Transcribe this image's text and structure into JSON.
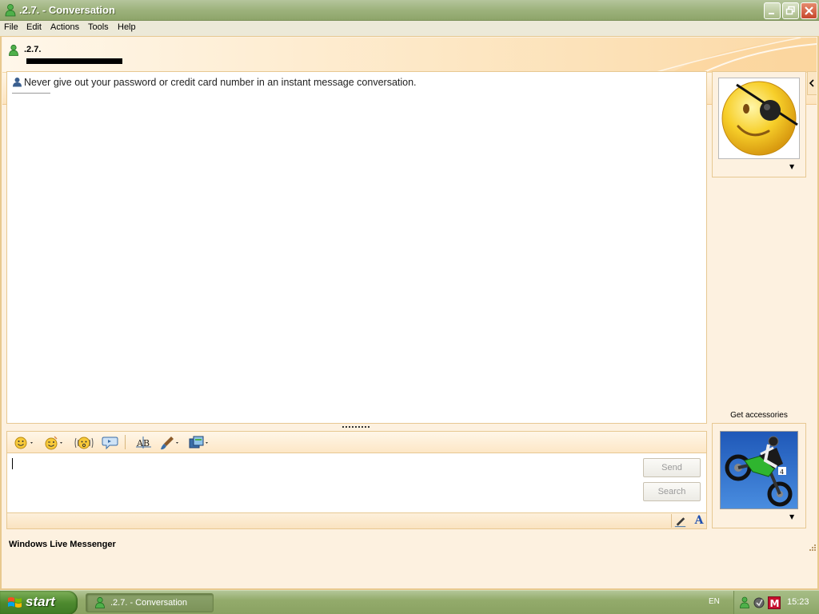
{
  "window": {
    "title": ".2.7. - Conversation",
    "brand": "Windows Live Messenger"
  },
  "menu": {
    "items": [
      "File",
      "Edit",
      "Actions",
      "Tools",
      "Help"
    ]
  },
  "contact": {
    "name": ".2.7.",
    "status_redacted": true
  },
  "toolbar": {
    "buttons": [
      "invite-contact",
      "share-files",
      "show-webcam",
      "call",
      "video-call",
      "activities",
      "block-contact"
    ]
  },
  "conversation": {
    "warning": "Never give out your password or credit card number in an instant message conversation."
  },
  "input": {
    "value": "",
    "send_label": "Send",
    "search_label": "Search"
  },
  "sidebar": {
    "get_accessories": "Get accessories"
  },
  "taskbar": {
    "start_label": "start",
    "task_label": ".2.7. - Conversation",
    "language": "EN",
    "clock": "15:23"
  },
  "colors": {
    "accent": "#9db27c",
    "panel": "#fdf1e0",
    "border": "#e7c892"
  }
}
